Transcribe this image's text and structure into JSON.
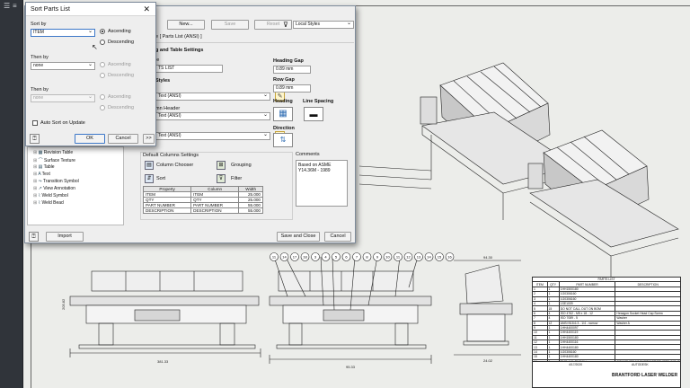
{
  "sort_dialog": {
    "title": "Sort Parts List",
    "sort_by_label": "Sort by",
    "sort_by_value": "ITEM",
    "then_by_label_1": "Then by",
    "then_by_value_1": "none",
    "then_by_label_2": "Then by",
    "then_by_value_2": "none",
    "ascending": "Ascending",
    "descending": "Descending",
    "auto_sort": "Auto Sort on Update",
    "ok": "OK",
    "cancel": "Cancel",
    "more": ">>"
  },
  "style_editor": {
    "toolbar": {
      "new": "New...",
      "save": "Save",
      "reset": "Reset",
      "filter_value": "Local Styles"
    },
    "header": "e [ Parts List (ANSI) ]",
    "section_title": "g and Table Settings",
    "title_partial": "le",
    "title_value": "TS LIST",
    "styles_partial": "Styles",
    "text_style_1": "Text (ANSI)",
    "column_header_partial": "mn Header",
    "text_style_2": "Text (ANSI)",
    "text_style_3": "Text (ANSI)",
    "heading_gap_label": "Heading Gap",
    "heading_gap_value": "0.89 mm",
    "row_gap_label": "Row Gap",
    "row_gap_value": "0.89 mm",
    "heading_label": "Heading",
    "line_spacing_label": "Line Spacing",
    "direction_label": "Direction",
    "default_columns_title": "Default Columns Settings",
    "column_chooser": "Column Chooser",
    "grouping": "Grouping",
    "sort": "Sort",
    "filter": "Filter",
    "columns_headers": [
      "Property",
      "Column",
      "Width"
    ],
    "columns_rows": [
      [
        "ITEM",
        "ITEM",
        "25.000"
      ],
      [
        "QTY",
        "QTY",
        "25.000"
      ],
      [
        "PART NUMBER",
        "PART NUMBER",
        "55.000"
      ],
      [
        "DESCRIPTION",
        "DESCRIPTION",
        "55.000"
      ]
    ],
    "comments_label": "Comments",
    "comments_value": "Based on ASME Y14.36M - 1989",
    "tree_items": [
      "Revision Table",
      "Surface Texture",
      "Table",
      "Text",
      "Transition Symbol",
      "View Annotation",
      "Weld Symbol",
      "Weld Bead"
    ],
    "import": "Import",
    "save_close": "Save and Close",
    "cancel": "Cancel"
  },
  "drawing": {
    "parts_list_title": "PARTS LIST",
    "parts_list_headers": [
      "ITEM",
      "QTY",
      "PART NUMBER",
      "DESCRIPTION"
    ],
    "parts_list_rows": [
      [
        "1",
        "1",
        "1HH1500180",
        ""
      ],
      [
        "2",
        "1",
        "1G0306160",
        ""
      ],
      [
        "3",
        "1",
        "1G0306160",
        ""
      ],
      [
        "4",
        "1",
        "1SE1009",
        ""
      ],
      [
        "5",
        "15",
        "DO NOT CALL OUT ON BOM",
        ""
      ],
      [
        "6",
        "4",
        "ISO 4762 - M5 x 18 - 12",
        "Hexagon Socket Head Cap Screw"
      ],
      [
        "7",
        "4",
        "ISO 7089 - 5",
        "Washer"
      ],
      [
        "8",
        "12",
        "ANSI B18.6.3 - 1/4 - narrow",
        "Washer A"
      ],
      [
        "9",
        "1",
        "1HH4400097",
        ""
      ],
      [
        "10",
        "1",
        "1HH4400119",
        ""
      ],
      [
        "11",
        "1",
        "1HH1500180",
        ""
      ],
      [
        "12",
        "1",
        "1HH4400116",
        ""
      ],
      [
        "13",
        "1",
        "1HH4400180",
        ""
      ],
      [
        "14",
        "1",
        "1G0306160",
        ""
      ],
      [
        "15",
        "1",
        "1HH4400180",
        ""
      ],
      [
        "16",
        "1",
        "BMC_1.8_PM4Wiring",
        "CONVEYOR MAGNETIC PRODUCTS, INC. P/N: 4"
      ],
      [
        "17",
        "1",
        "BMC_1.8_PM4Wiring",
        "CONVEYOR MAGNETIC PRODUCTS, INC. P/N: 4"
      ],
      [
        "18",
        "1",
        "1HH4400180",
        ""
      ]
    ],
    "title_block_date": "4/17/2020",
    "title_block_company": "AUTODESK",
    "drawing_title": "BRANTFORD LASER WELDER",
    "balloons": [
      "11",
      "14",
      "17",
      "18",
      "3",
      "4",
      "5",
      "6",
      "7",
      "8",
      "9",
      "10",
      "11",
      "12",
      "13",
      "14",
      "15",
      "16"
    ],
    "dim_overall": "381.33",
    "dim_mid": "95.33",
    "dim_right": "94.30",
    "dim_right_bottom": "24.02",
    "dim_w2": "205.82"
  }
}
